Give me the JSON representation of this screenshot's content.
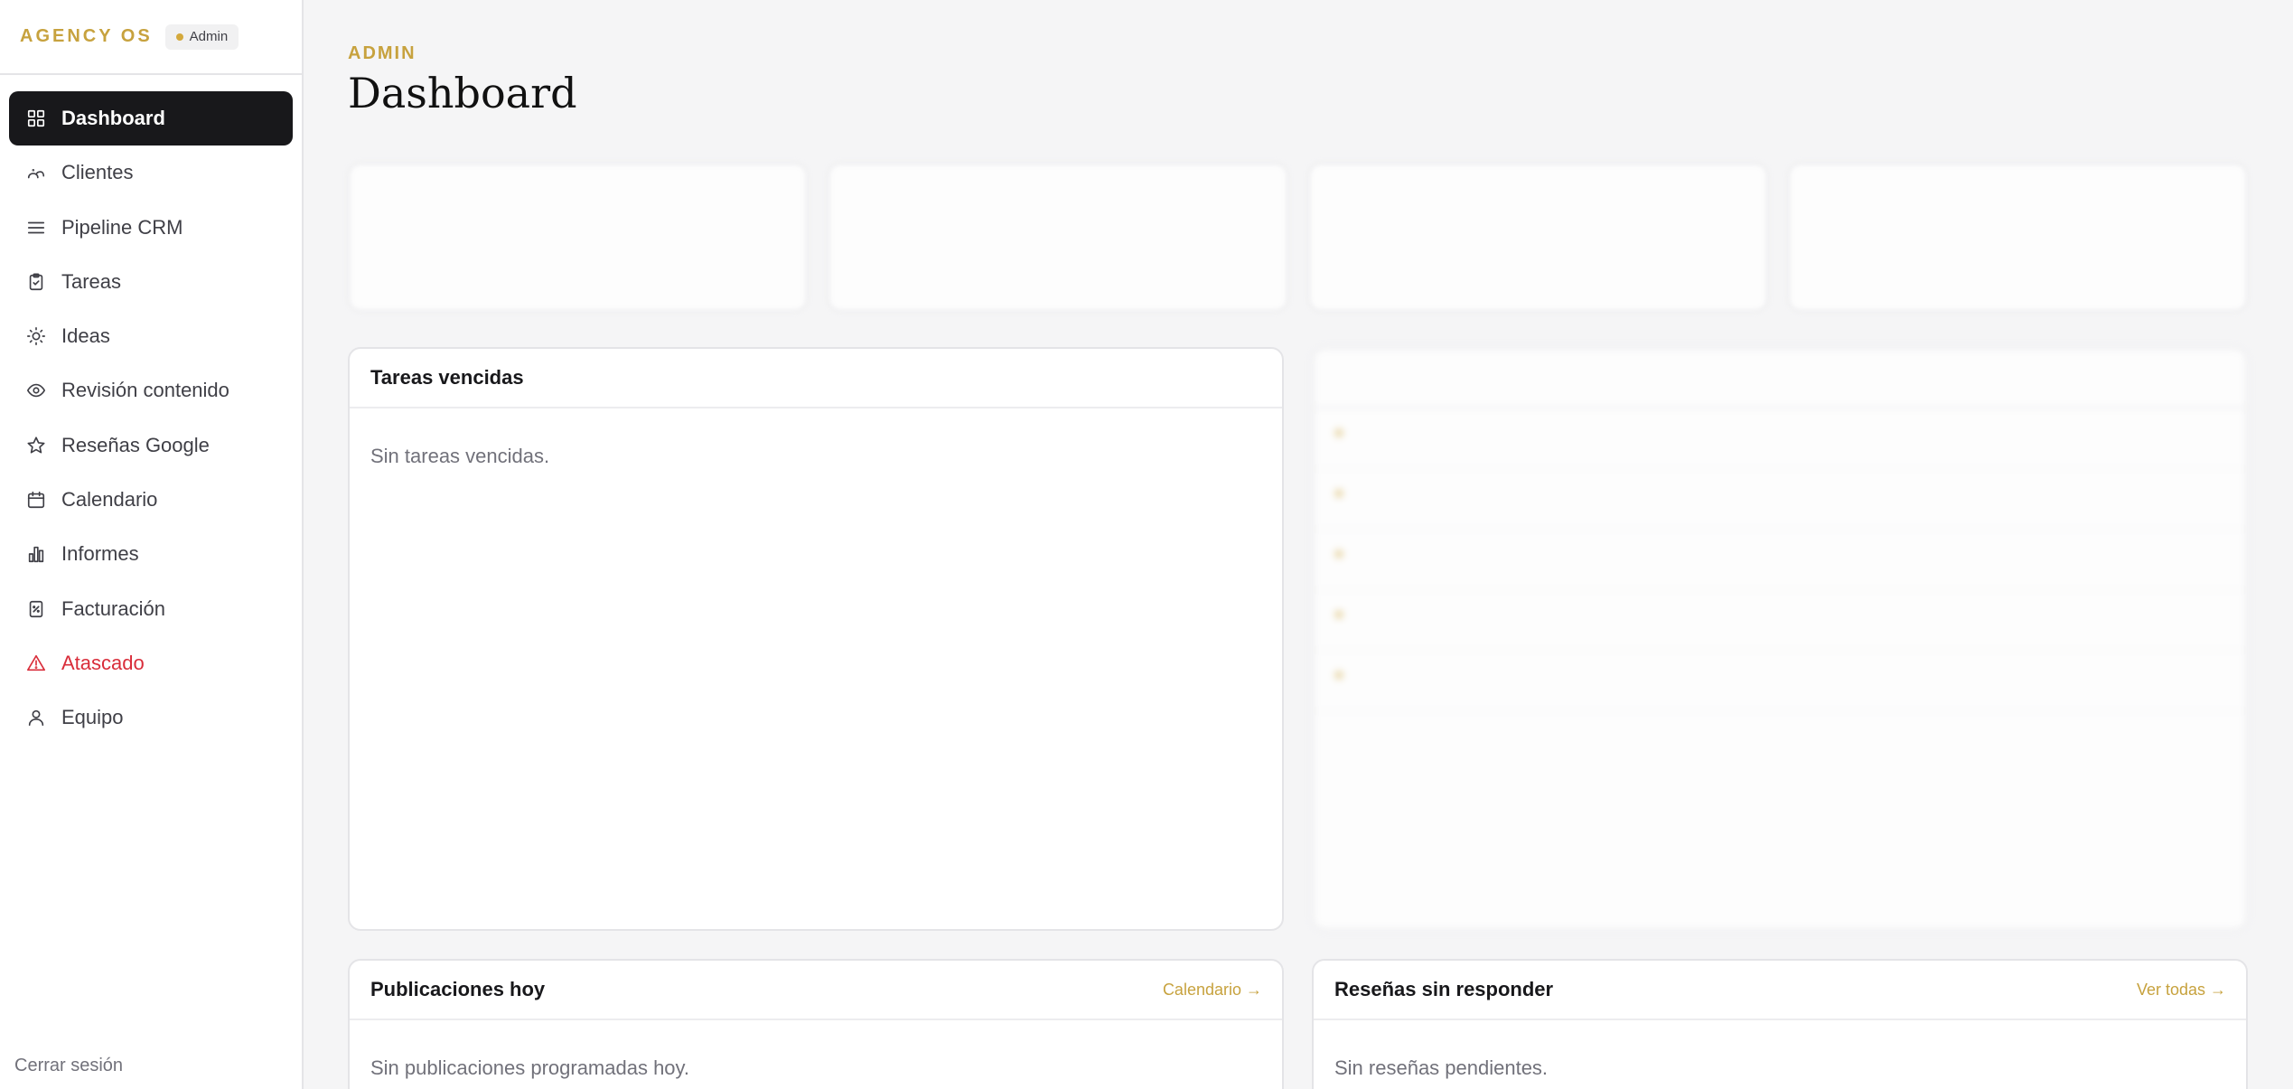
{
  "brand": {
    "name": "AGENCY OS",
    "role": "Admin"
  },
  "nav": {
    "items": [
      {
        "label": "Dashboard",
        "icon": "grid-icon",
        "active": true
      },
      {
        "label": "Clientes",
        "icon": "clients-icon"
      },
      {
        "label": "Pipeline CRM",
        "icon": "list-icon"
      },
      {
        "label": "Tareas",
        "icon": "clipboard-icon"
      },
      {
        "label": "Ideas",
        "icon": "lightbulb-icon"
      },
      {
        "label": "Revisión contenido",
        "icon": "eye-icon"
      },
      {
        "label": "Reseñas Google",
        "icon": "star-icon"
      },
      {
        "label": "Calendario",
        "icon": "calendar-icon"
      },
      {
        "label": "Informes",
        "icon": "bar-chart-icon"
      },
      {
        "label": "Facturación",
        "icon": "invoice-icon"
      },
      {
        "label": "Atascado",
        "icon": "warning-icon",
        "danger": true
      },
      {
        "label": "Equipo",
        "icon": "team-icon"
      }
    ],
    "logout": "Cerrar sesión"
  },
  "header": {
    "eyebrow": "ADMIN",
    "title": "Dashboard"
  },
  "overdue": {
    "title": "Tareas vencidas",
    "empty": "Sin tareas vencidas."
  },
  "posts": {
    "title": "Publicaciones hoy",
    "link": "Calendario →",
    "empty": "Sin publicaciones programadas hoy."
  },
  "reviews": {
    "title": "Reseñas sin responder",
    "link": "Ver todas →",
    "empty": "Sin reseñas pendientes."
  },
  "colors": {
    "accent": "#c7a23e",
    "active_bg": "#18181b",
    "danger": "#d92d3a"
  }
}
